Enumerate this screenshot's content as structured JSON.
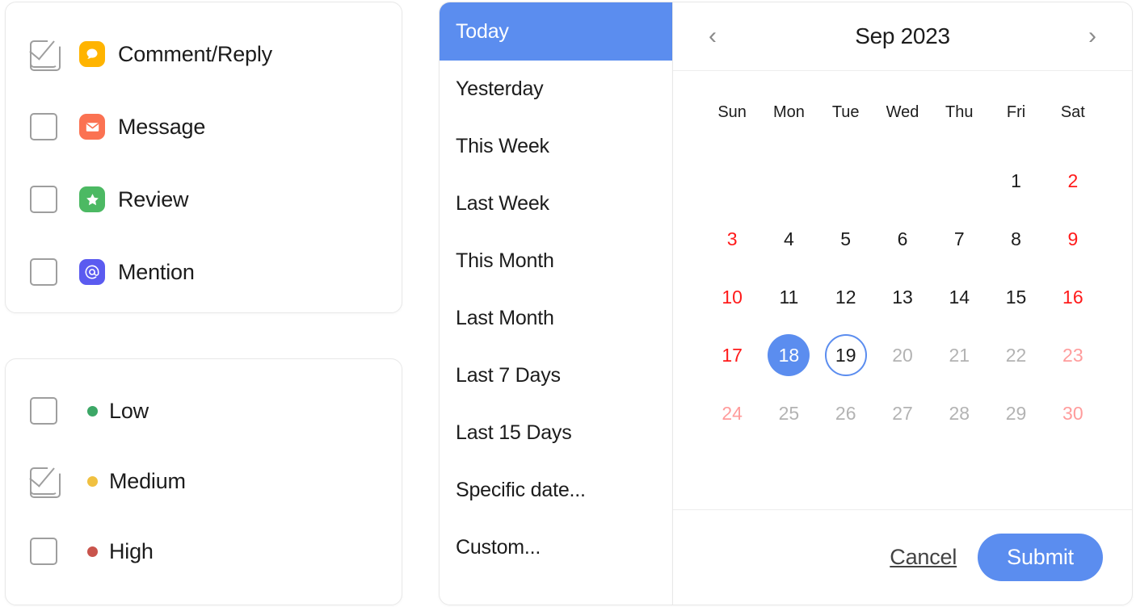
{
  "notification_types": {
    "items": [
      {
        "label": "Comment/Reply",
        "checked": true,
        "icon": "comment-bubble-icon",
        "color": "#FFB400"
      },
      {
        "label": "Message",
        "checked": false,
        "icon": "envelope-icon",
        "color": "#FB7252"
      },
      {
        "label": "Review",
        "checked": false,
        "icon": "star-icon",
        "color": "#4CB963"
      },
      {
        "label": "Mention",
        "checked": false,
        "icon": "at-sign-icon",
        "color": "#5B5BF0"
      }
    ]
  },
  "priority": {
    "items": [
      {
        "label": "Low",
        "checked": false,
        "color": "#3CA766"
      },
      {
        "label": "Medium",
        "checked": true,
        "color": "#F0C040"
      },
      {
        "label": "High",
        "checked": false,
        "color": "#C9544C"
      }
    ]
  },
  "date_ranges": {
    "items": [
      {
        "label": "Today",
        "active": true
      },
      {
        "label": "Yesterday",
        "active": false
      },
      {
        "label": "This Week",
        "active": false
      },
      {
        "label": "Last Week",
        "active": false
      },
      {
        "label": "This Month",
        "active": false
      },
      {
        "label": "Last Month",
        "active": false
      },
      {
        "label": "Last 7 Days",
        "active": false
      },
      {
        "label": "Last 15 Days",
        "active": false
      },
      {
        "label": "Specific date...",
        "active": false
      },
      {
        "label": "Custom...",
        "active": false
      }
    ]
  },
  "calendar": {
    "title": "Sep 2023",
    "prev_label": "‹",
    "next_label": "›",
    "weekdays": [
      "Sun",
      "Mon",
      "Tue",
      "Wed",
      "Thu",
      "Fri",
      "Sat"
    ],
    "leading_blanks": 5,
    "days": [
      {
        "n": "1",
        "state": "normal"
      },
      {
        "n": "2",
        "state": "weekend"
      },
      {
        "n": "3",
        "state": "weekend"
      },
      {
        "n": "4",
        "state": "normal"
      },
      {
        "n": "5",
        "state": "normal"
      },
      {
        "n": "6",
        "state": "normal"
      },
      {
        "n": "7",
        "state": "normal"
      },
      {
        "n": "8",
        "state": "normal"
      },
      {
        "n": "9",
        "state": "weekend"
      },
      {
        "n": "10",
        "state": "weekend"
      },
      {
        "n": "11",
        "state": "normal"
      },
      {
        "n": "12",
        "state": "normal"
      },
      {
        "n": "13",
        "state": "normal"
      },
      {
        "n": "14",
        "state": "normal"
      },
      {
        "n": "15",
        "state": "normal"
      },
      {
        "n": "16",
        "state": "weekend"
      },
      {
        "n": "17",
        "state": "weekend"
      },
      {
        "n": "18",
        "state": "selected"
      },
      {
        "n": "19",
        "state": "today"
      },
      {
        "n": "20",
        "state": "muted"
      },
      {
        "n": "21",
        "state": "muted"
      },
      {
        "n": "22",
        "state": "muted"
      },
      {
        "n": "23",
        "state": "muted-weekend"
      },
      {
        "n": "24",
        "state": "muted-weekend"
      },
      {
        "n": "25",
        "state": "muted"
      },
      {
        "n": "26",
        "state": "muted"
      },
      {
        "n": "27",
        "state": "muted"
      },
      {
        "n": "28",
        "state": "muted"
      },
      {
        "n": "29",
        "state": "muted"
      },
      {
        "n": "30",
        "state": "muted-weekend"
      }
    ],
    "footer": {
      "cancel_label": "Cancel",
      "submit_label": "Submit"
    }
  },
  "colors": {
    "accent_blue": "#5B8DEF",
    "weekend_red": "#FF1A1A",
    "muted_gray": "#B3B3B3"
  }
}
